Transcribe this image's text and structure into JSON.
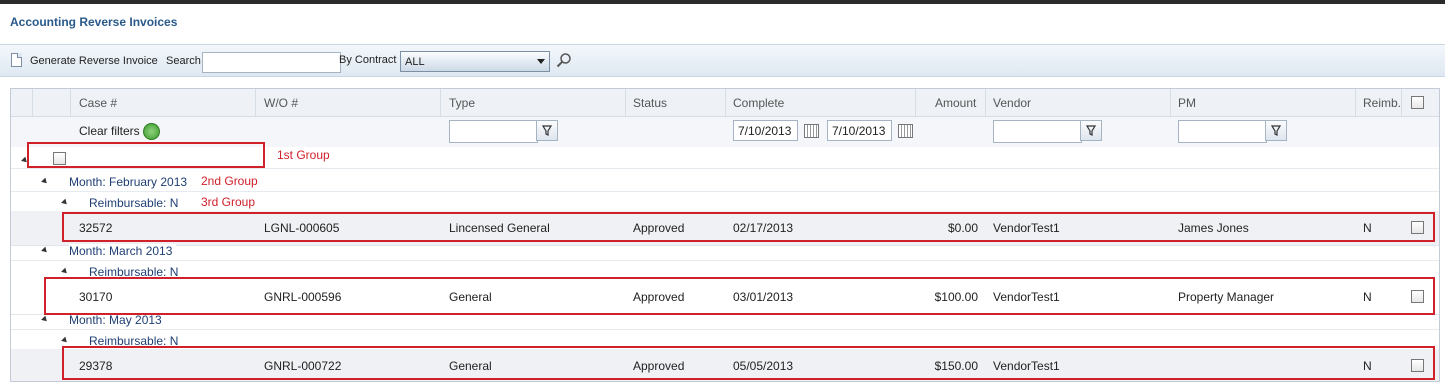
{
  "page": {
    "title": "Accounting Reverse Invoices"
  },
  "toolbar": {
    "generate_label": "Generate Reverse Invoice",
    "search_label": "Search",
    "search_value": "",
    "by_contract_label": "By Contract",
    "contract_selected": "ALL"
  },
  "grid": {
    "columns": [
      "Case #",
      "W/O #",
      "Type",
      "Status",
      "Complete",
      "Amount",
      "Vendor",
      "PM",
      "Reimb."
    ],
    "filters": {
      "clear_label": "Clear filters",
      "type_value": "",
      "complete_from": "7/10/2013",
      "complete_to": "7/10/2013",
      "vendor_value": "",
      "pm_value": ""
    },
    "groups": [
      {
        "month": "Month: February 2013",
        "reimb": "Reimbursable: N",
        "row": {
          "case": "32572",
          "wo": "LGNL-000605",
          "type": "Lincensed General",
          "status": "Approved",
          "complete": "02/17/2013",
          "amount": "$0.00",
          "vendor": "VendorTest1",
          "pm": "James Jones",
          "reimb": "N"
        }
      },
      {
        "month": "Month: March 2013",
        "reimb": "Reimbursable: N",
        "row": {
          "case": "30170",
          "wo": "GNRL-000596",
          "type": "General",
          "status": "Approved",
          "complete": "03/01/2013",
          "amount": "$100.00",
          "vendor": "VendorTest1",
          "pm": "Property Manager",
          "reimb": "N"
        }
      },
      {
        "month": "Month: May 2013",
        "reimb": "Reimbursable: N",
        "row": {
          "case": "29378",
          "wo": "GNRL-000722",
          "type": "General",
          "status": "Approved",
          "complete": "05/05/2013",
          "amount": "$150.00",
          "vendor": "VendorTest1",
          "pm": "",
          "reimb": "N"
        }
      }
    ]
  },
  "annotations": {
    "first": "1st Group",
    "second": "2nd Group",
    "third": "3rd Group"
  },
  "colors": {
    "accent": "#2a5a8a",
    "group_text": "#1f3f74",
    "highlight": "#d0202a"
  }
}
